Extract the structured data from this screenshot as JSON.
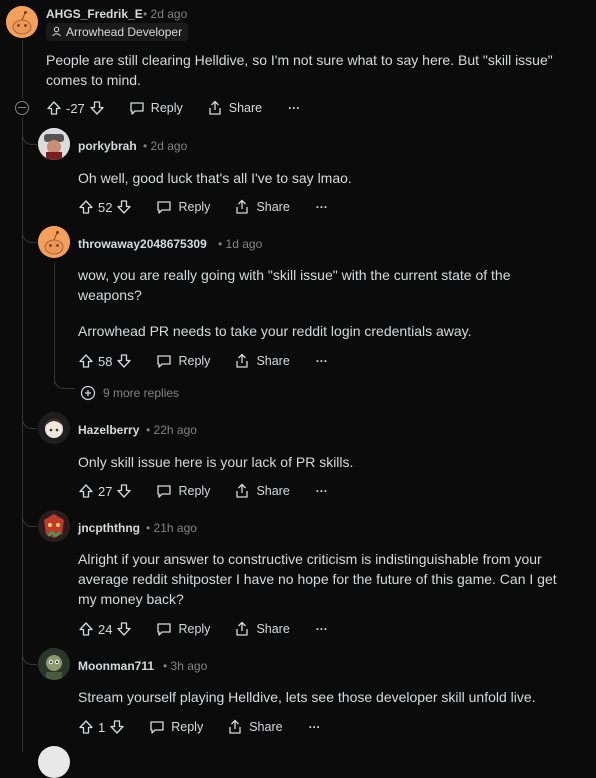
{
  "root_comment": {
    "username": "AHGS_Fredrik_E",
    "time": "2d ago",
    "flair": "Arrowhead Developer",
    "body": "People are still clearing Helldive, so I'm not sure what to say here. But \"skill issue\" comes to mind.",
    "score": "-27",
    "reply_label": "Reply",
    "share_label": "Share",
    "more_label": "···"
  },
  "replies": [
    {
      "username": "porkybrah",
      "time": "2d ago",
      "body": [
        "Oh well, good luck that's all I've to say lmao."
      ],
      "score": "52",
      "reply_label": "Reply",
      "share_label": "Share",
      "more_label": "···"
    },
    {
      "username": "throwaway2048675309",
      "time": "1d ago",
      "body": [
        "wow, you are really going with \"skill issue\" with the current state of the weapons?",
        "Arrowhead PR needs to take your reddit login credentials away."
      ],
      "score": "58",
      "reply_label": "Reply",
      "share_label": "Share",
      "more_label": "···",
      "more_replies": "9 more replies"
    },
    {
      "username": "Hazelberry",
      "time": "22h ago",
      "body": [
        "Only skill issue here is your lack of PR skills."
      ],
      "score": "27",
      "reply_label": "Reply",
      "share_label": "Share",
      "more_label": "···"
    },
    {
      "username": "jncpththng",
      "time": "21h ago",
      "body": [
        "Alright if your answer to constructive criticism is indistinguishable from your average reddit shitposter I have no hope for the future of this game. Can I get my money back?"
      ],
      "score": "24",
      "reply_label": "Reply",
      "share_label": "Share",
      "more_label": "···"
    },
    {
      "username": "Moonman711",
      "time": "3h ago",
      "body": [
        "Stream yourself playing Helldive, lets see those developer skill unfold live."
      ],
      "score": "1",
      "reply_label": "Reply",
      "share_label": "Share",
      "more_label": "···"
    }
  ],
  "colors": {
    "background": "#0b0b0b",
    "text": "#d7dadc",
    "muted": "#818384",
    "avatar_orange": "#f2a05b"
  },
  "icons": [
    "upvote-icon",
    "downvote-icon",
    "reply-bubble-icon",
    "share-icon",
    "more-icon",
    "collapse-icon",
    "plus-circle-icon",
    "developer-flair-icon"
  ]
}
